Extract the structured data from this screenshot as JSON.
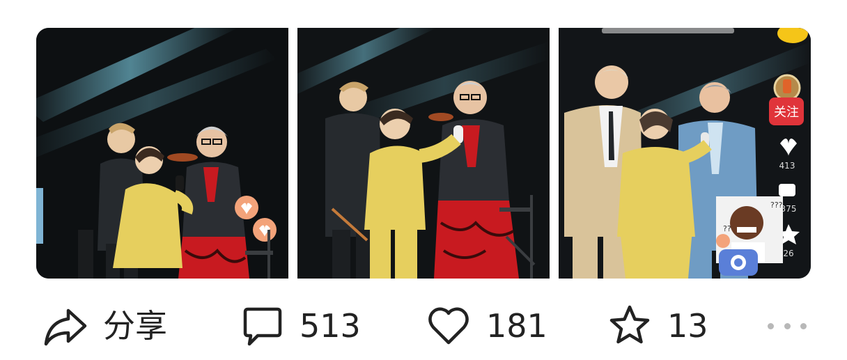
{
  "gallery": {
    "photos": [
      {
        "name": "photo-1"
      },
      {
        "name": "photo-2"
      },
      {
        "name": "photo-3"
      }
    ],
    "overlay": {
      "follow_label": "关注",
      "like_count": "413",
      "comment_count": "375",
      "favorite_count": "26"
    }
  },
  "actions": {
    "share_label": "分享",
    "comment_count": "513",
    "like_count": "181",
    "favorite_count": "13"
  },
  "colors": {
    "background": "#ffffff",
    "text": "#222222",
    "more_dots": "#b8b8b8",
    "follow_badge": "#e0343a",
    "stage_dark": "#0d1012",
    "suit_yellow": "#e6cf5e",
    "skirt_red": "#c81a20",
    "suit_tan": "#d9c39a",
    "suit_blue": "#6f9cc4"
  },
  "icons": {
    "share": "share-arrow-icon",
    "comment": "comment-bubble-icon",
    "like": "heart-outline-icon",
    "favorite": "star-outline-icon",
    "more": "more-dots-icon"
  }
}
